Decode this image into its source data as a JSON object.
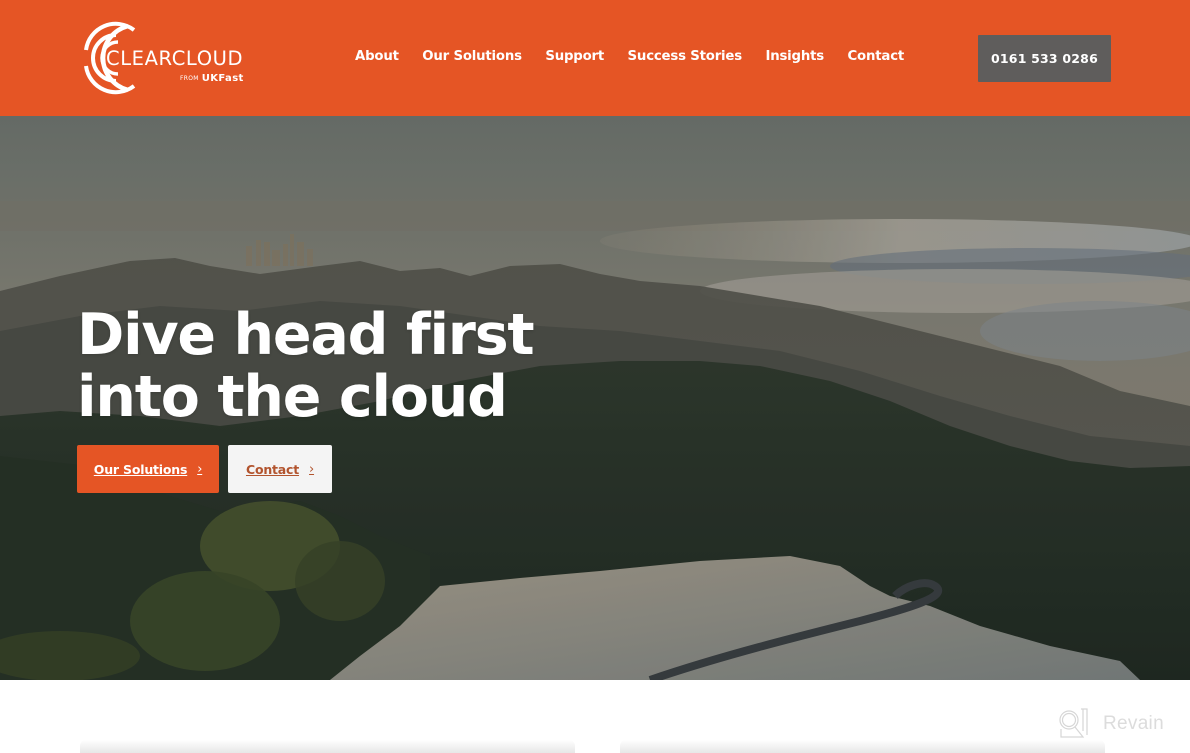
{
  "header": {
    "brand_color": "#e55525",
    "logo": {
      "name": "CLEARCLOUD",
      "from_label": "FROM",
      "parent_brand": "UKFast",
      "icon": "clearcloud-arc-logo-icon"
    },
    "nav": [
      {
        "label": "About"
      },
      {
        "label": "Our Solutions"
      },
      {
        "label": "Support"
      },
      {
        "label": "Success Stories"
      },
      {
        "label": "Insights"
      },
      {
        "label": "Contact"
      }
    ],
    "phone_button": {
      "label": "0161 533 0286",
      "color": "#5f5d5c"
    }
  },
  "hero": {
    "title_line1": "Dive head first",
    "title_line2": "into the cloud",
    "background": "misty-forest-mountain-landscape-image",
    "buttons": {
      "primary": {
        "label": "Our Solutions",
        "icon": "chevron-right-icon",
        "color": "#e55525"
      },
      "secondary": {
        "label": "Contact",
        "icon": "chevron-right-icon",
        "color": "#f4f4f4"
      }
    },
    "chevron": "›"
  },
  "watermark": {
    "label": "Revain",
    "icon": "revain-logo-icon"
  }
}
